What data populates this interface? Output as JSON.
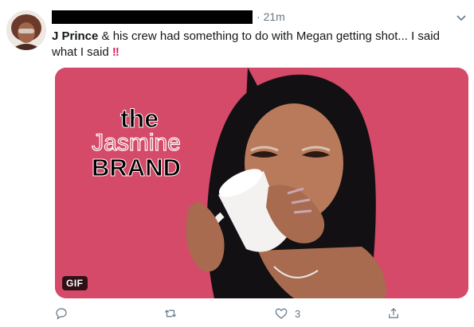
{
  "tweet": {
    "timestamp": "21m",
    "author_mention": "J Prince",
    "text_rest": " & his crew had something to do with Megan getting shot... I said what I said ",
    "emphasis": "!!",
    "media": {
      "logo_line1": "the",
      "logo_line2": "Jasmine",
      "logo_line3": "BRAND",
      "badge": "GIF"
    },
    "actions": {
      "reply_count": "",
      "retweet_count": "",
      "like_count": "3"
    }
  },
  "icons": [
    "caret-down-icon",
    "reply-icon",
    "retweet-icon",
    "like-icon",
    "share-icon"
  ],
  "colors": {
    "media_bg": "#d44a68",
    "muted": "#657786",
    "text": "#14171a",
    "bang": "#e0245e"
  }
}
